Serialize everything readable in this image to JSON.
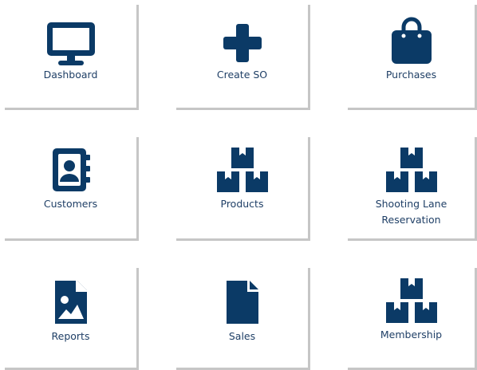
{
  "colors": {
    "icon": "#0b3a66",
    "label": "#1f3f66",
    "tile_shadow": "#c6c6c6",
    "background": "#ffffff"
  },
  "tiles": [
    {
      "label": "Dashboard",
      "icon": "monitor-icon"
    },
    {
      "label": "Create SO",
      "icon": "plus-icon"
    },
    {
      "label": "Purchases",
      "icon": "shopping-bag-icon"
    },
    {
      "label": "Customers",
      "icon": "address-book-icon"
    },
    {
      "label": "Products",
      "icon": "boxes-icon"
    },
    {
      "label": "Shooting Lane\nReservation",
      "icon": "boxes-icon"
    },
    {
      "label": "Reports",
      "icon": "image-file-icon"
    },
    {
      "label": "Sales",
      "icon": "file-icon"
    },
    {
      "label": "Membership",
      "icon": "boxes-icon"
    }
  ]
}
